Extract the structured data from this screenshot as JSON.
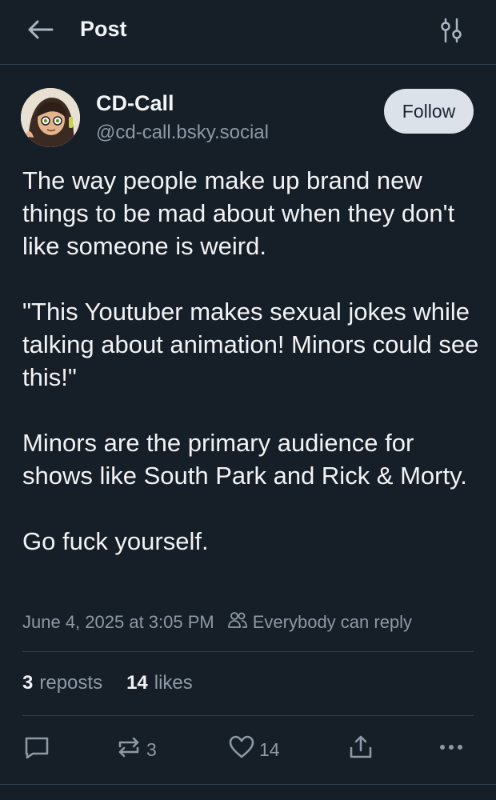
{
  "header": {
    "title": "Post",
    "back_icon": "arrow-left-icon",
    "filter_icon": "sliders-icon"
  },
  "author": {
    "display_name": "CD-Call",
    "handle": "@cd-call.bsky.social",
    "follow_label": "Follow"
  },
  "post": {
    "paragraphs": [
      "The way people make up brand new things to be mad about when they don't like someone is weird.",
      "\"This Youtuber makes sexual jokes while talking about animation! Minors could see this!\"",
      "Minors are the primary audience for shows like South Park and Rick & Morty.",
      "Go fuck yourself."
    ],
    "timestamp": "June 4, 2025 at 3:05 PM",
    "reply_setting": "Everybody can reply"
  },
  "stats": {
    "reposts_count": "3",
    "reposts_label": "reposts",
    "likes_count": "14",
    "likes_label": "likes"
  },
  "actions": {
    "repost_count": "3",
    "like_count": "14"
  },
  "colors": {
    "background": "#161e27",
    "divider": "#2e4052",
    "muted_text": "#8d99a6",
    "follow_bg": "#dce2ea"
  }
}
